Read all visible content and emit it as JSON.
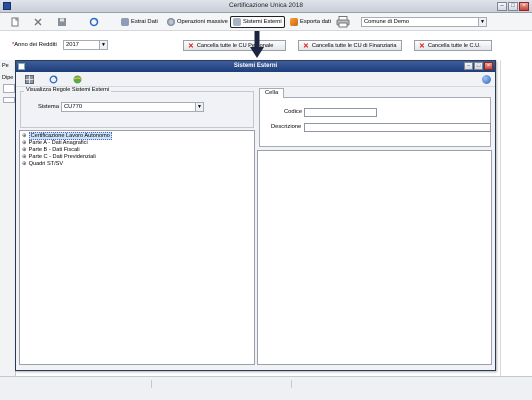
{
  "window": {
    "title": "Certificazione Unica 2018"
  },
  "toolbar": {
    "extract_label": "Estrai Dati",
    "bulk_ops_label": "Operazioni massive",
    "ext_systems_label": "Sistemi Esterni",
    "export_label": "Esporta dati",
    "entity_select": "Comune di Demo"
  },
  "filters": {
    "year_label": "Anno dei Redditi",
    "year_value": "2017"
  },
  "actions": {
    "delete_personal_label": "Cancella tutte le CU Personale",
    "delete_financial_label": "Cancella tutte le CU di Finanziaria",
    "delete_all_label": "Cancella tutte le C.U."
  },
  "background": {
    "tab_prefix": "Pe",
    "dip_prefix": "Dipe"
  },
  "dialog": {
    "title": "Sistemi Esterni",
    "group_title": "Visualizza Regole Sistemi Esterni",
    "system_label": "Sistema",
    "system_value": "CU770",
    "tree": [
      {
        "label": "Certificazione Lavoro Autonomo",
        "selected": true
      },
      {
        "label": "Parte A - Dati Anagrafici",
        "selected": false
      },
      {
        "label": "Parte B - Dati Fiscali",
        "selected": false
      },
      {
        "label": "Parte C - Dati Previdenziali",
        "selected": false
      },
      {
        "label": "Quadri ST/SV",
        "selected": false
      }
    ],
    "tab_label": "Cella",
    "code_label": "Codice",
    "code_value": "",
    "description_label": "Descrizione",
    "description_value": ""
  },
  "colors": {
    "title_bar": "#1d3d79",
    "accent_red": "#d11111"
  },
  "icons": [
    "new-icon",
    "delete-icon",
    "save-icon",
    "refresh-icon",
    "grid-icon",
    "globe-icon",
    "printer-icon",
    "help-icon",
    "arrow-down-icon"
  ]
}
